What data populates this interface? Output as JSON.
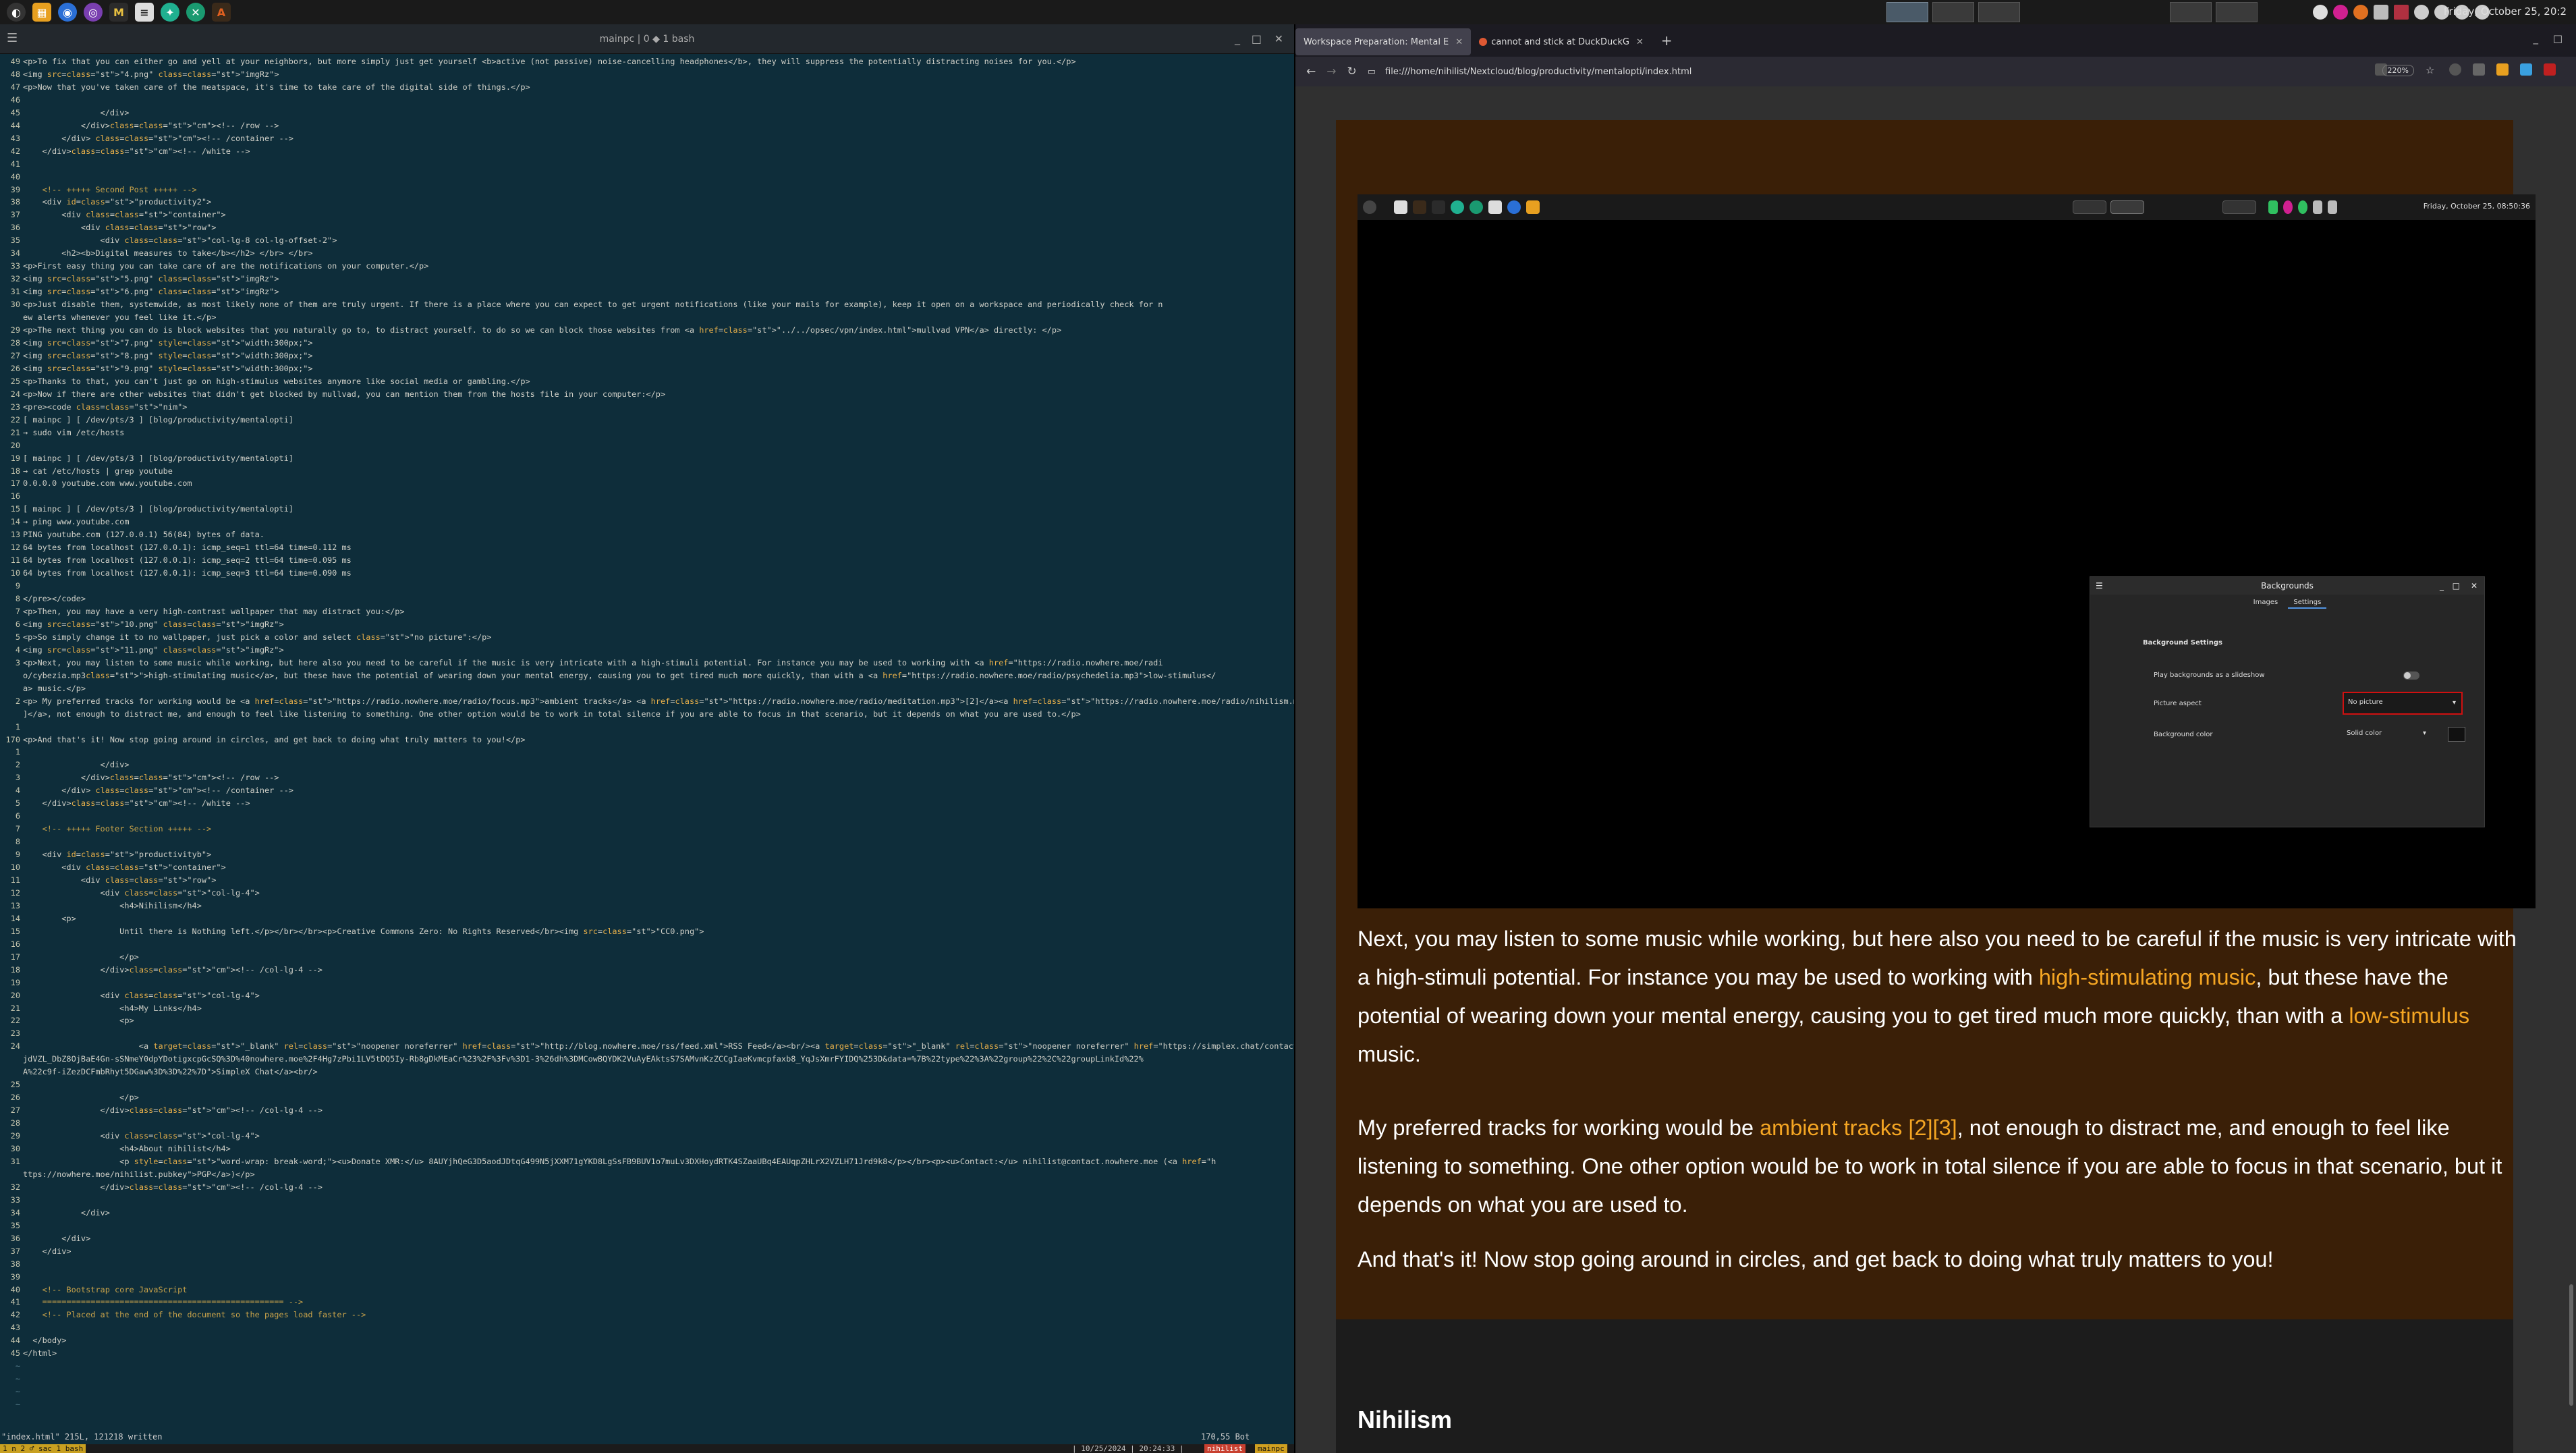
{
  "panel": {
    "launcher_icons": [
      "app-menu-icon",
      "files-icon",
      "firefox-icon",
      "tor-icon",
      "thunderbird-icon",
      "editor-icon",
      "app-icon",
      "app-icon",
      "app-icon"
    ],
    "clock": "Friday, October 25, 20:2"
  },
  "terminal": {
    "title": "mainpc | 0 ◆ 1 bash",
    "status_left": "\"index.html\" 215L, 121218 written",
    "status_right": "170,55        Bot",
    "tmux_left": "1 n    2 ♂ sac    1 bash",
    "tmux_date": "| 10/25/2024 | 20:24:33 |",
    "tmux_user": "nihilist",
    "tmux_host": "mainpc"
  },
  "code_lines": [
    {
      "n": "49",
      "t": "<p>To fix that you can either go and yell at your neighbors, but more simply just get yourself <b>active (not passive) noise-cancelling headphones</b>, they will suppress the potentially distracting noises for you.</p>"
    },
    {
      "n": "48",
      "t": "<img src=\"4.png\" class=\"imgRz\">"
    },
    {
      "n": "47",
      "t": "<p>Now that you've taken care of the meatspace, it's time to take care of the digital side of things.</p>"
    },
    {
      "n": "46",
      "t": ""
    },
    {
      "n": "45",
      "t": "                </div>"
    },
    {
      "n": "44",
      "t": "            </div><!-- /row -->"
    },
    {
      "n": "43",
      "t": "        </div> <!-- /container -->"
    },
    {
      "n": "42",
      "t": "    </div><!-- /white -->"
    },
    {
      "n": "41",
      "t": ""
    },
    {
      "n": "40",
      "t": ""
    },
    {
      "n": "39",
      "t": "    <!-- +++++ Second Post +++++ -->"
    },
    {
      "n": "38",
      "t": "    <div id=\"productivity2\">"
    },
    {
      "n": "37",
      "t": "        <div class=\"container\">"
    },
    {
      "n": "36",
      "t": "            <div class=\"row\">"
    },
    {
      "n": "35",
      "t": "                <div class=\"col-lg-8 col-lg-offset-2\">"
    },
    {
      "n": "34",
      "t": "        <h2><b>Digital measures to take</b></h2> </br> </br>"
    },
    {
      "n": "33",
      "t": "<p>First easy thing you can take care of are the notifications on your computer.</p>"
    },
    {
      "n": "32",
      "t": "<img src=\"5.png\" class=\"imgRz\">"
    },
    {
      "n": "31",
      "t": "<img src=\"6.png\" class=\"imgRz\">"
    },
    {
      "n": "30",
      "t": "<p>Just disable them, systemwide, as most likely none of them are truly urgent. If there is a place where you can expect to get urgent notifications (like your mails for example), keep it open on a workspace and periodically check for n"
    },
    {
      "n": "",
      "t": "ew alerts whenever you feel like it.</p>"
    },
    {
      "n": "29",
      "t": "<p>The next thing you can do is block websites that you naturally go to, to distract yourself. to do so we can block those websites from <a href=\"../../opsec/vpn/index.html\">mullvad VPN</a> directly: </p>"
    },
    {
      "n": "28",
      "t": "<img src=\"7.png\" style=\"width:300px;\">"
    },
    {
      "n": "27",
      "t": "<img src=\"8.png\" style=\"width:300px;\">"
    },
    {
      "n": "26",
      "t": "<img src=\"9.png\" style=\"width:300px;\">"
    },
    {
      "n": "25",
      "t": "<p>Thanks to that, you can't just go on high-stimulus websites anymore like social media or gambling.</p>"
    },
    {
      "n": "24",
      "t": "<p>Now if there are other websites that didn't get blocked by mullvad, you can mention them from the hosts file in your computer:</p>"
    },
    {
      "n": "23",
      "t": "<pre><code class=\"nim\">"
    },
    {
      "n": "22",
      "t": "[ mainpc ] [ /dev/pts/3 ] [blog/productivity/mentalopti]"
    },
    {
      "n": "21",
      "t": "→ sudo vim /etc/hosts"
    },
    {
      "n": "20",
      "t": ""
    },
    {
      "n": "19",
      "t": "[ mainpc ] [ /dev/pts/3 ] [blog/productivity/mentalopti]"
    },
    {
      "n": "18",
      "t": "→ cat /etc/hosts | grep youtube"
    },
    {
      "n": "17",
      "t": "0.0.0.0 youtube.com www.youtube.com"
    },
    {
      "n": "16",
      "t": ""
    },
    {
      "n": "15",
      "t": "[ mainpc ] [ /dev/pts/3 ] [blog/productivity/mentalopti]"
    },
    {
      "n": "14",
      "t": "→ ping www.youtube.com"
    },
    {
      "n": "13",
      "t": "PING youtube.com (127.0.0.1) 56(84) bytes of data."
    },
    {
      "n": "12",
      "t": "64 bytes from localhost (127.0.0.1): icmp_seq=1 ttl=64 time=0.112 ms"
    },
    {
      "n": "11",
      "t": "64 bytes from localhost (127.0.0.1): icmp_seq=2 ttl=64 time=0.095 ms"
    },
    {
      "n": "10",
      "t": "64 bytes from localhost (127.0.0.1): icmp_seq=3 ttl=64 time=0.090 ms"
    },
    {
      "n": "9",
      "t": ""
    },
    {
      "n": "8",
      "t": "</pre></code>"
    },
    {
      "n": "7",
      "t": "<p>Then, you may have a very high-contrast wallpaper that may distract you:</p>"
    },
    {
      "n": "6",
      "t": "<img src=\"10.png\" class=\"imgRz\">"
    },
    {
      "n": "5",
      "t": "<p>So simply change it to no wallpaper, just pick a color and select \"no picture\":</p>"
    },
    {
      "n": "4",
      "t": "<img src=\"11.png\" class=\"imgRz\">"
    },
    {
      "n": "3",
      "t": "<p>Next, you may listen to some music while working, but here also you need to be careful if the music is very intricate with a high-stimuli potential. For instance you may be used to working with <a href=\"https://radio.nowhere.moe/radi"
    },
    {
      "n": "",
      "t": "o/cybezia.mp3\">high-stimulating music</a>, but these have the potential of wearing down your mental energy, causing you to get tired much more quickly, than with a <a href=\"https://radio.nowhere.moe/radio/psychedelia.mp3\">low-stimulus</"
    },
    {
      "n": "",
      "t": "a> music.</p>"
    },
    {
      "n": "2",
      "t": "<p> My preferred tracks for working would be <a href=\"https://radio.nowhere.moe/radio/focus.mp3\">ambient tracks</a> <a href=\"https://radio.nowhere.moe/radio/meditation.mp3\">[2]</a><a href=\"https://radio.nowhere.moe/radio/nihilism.mp3\">[3"
    },
    {
      "n": "",
      "t": "]</a>, not enough to distract me, and enough to feel like listening to something. One other option would be to work in total silence if you are able to focus in that scenario, but it depends on what you are used to.</p>"
    },
    {
      "n": "1",
      "t": ""
    },
    {
      "n": "170",
      "t": "<p>And that's it! Now stop going around in circles, and get back to doing what truly matters to you!</p>"
    },
    {
      "n": "1",
      "t": ""
    },
    {
      "n": "2",
      "t": "                </div>"
    },
    {
      "n": "3",
      "t": "            </div><!-- /row -->"
    },
    {
      "n": "4",
      "t": "        </div> <!-- /container -->"
    },
    {
      "n": "5",
      "t": "    </div><!-- /white -->"
    },
    {
      "n": "6",
      "t": ""
    },
    {
      "n": "7",
      "t": "    <!-- +++++ Footer Section +++++ -->"
    },
    {
      "n": "8",
      "t": ""
    },
    {
      "n": "9",
      "t": "    <div id=\"productivityb\">"
    },
    {
      "n": "10",
      "t": "        <div class=\"container\">"
    },
    {
      "n": "11",
      "t": "            <div class=\"row\">"
    },
    {
      "n": "12",
      "t": "                <div class=\"col-lg-4\">"
    },
    {
      "n": "13",
      "t": "                    <h4>Nihilism</h4>"
    },
    {
      "n": "14",
      "t": "        <p>"
    },
    {
      "n": "15",
      "t": "                    Until there is Nothing left.</p></br></br><p>Creative Commons Zero: No Rights Reserved</br><img src=\"CC0.png\">"
    },
    {
      "n": "16",
      "t": ""
    },
    {
      "n": "17",
      "t": "                    </p>"
    },
    {
      "n": "18",
      "t": "                </div><!-- /col-lg-4 -->"
    },
    {
      "n": "19",
      "t": ""
    },
    {
      "n": "20",
      "t": "                <div class=\"col-lg-4\">"
    },
    {
      "n": "21",
      "t": "                    <h4>My Links</h4>"
    },
    {
      "n": "22",
      "t": "                    <p>"
    },
    {
      "n": "23",
      "t": ""
    },
    {
      "n": "24",
      "t": "                        <a target=\"_blank\" rel=\"noopener noreferrer\" href=\"http://blog.nowhere.moe/rss/feed.xml\">RSS Feed</a><br/><a target=\"_blank\" rel=\"noopener noreferrer\" href=\"https://simplex.chat/contact#/?v=2-7&smp=smp%3A%2F%2FL5"
    },
    {
      "n": "",
      "t": "jdVZL_DbZ8OjBaE4Gn-sSNmeY0dpYDotigxcpGcSQ%3D%40nowhere.moe%2F4Hg7zPbi1LV5tDQ5Iy-Rb8gDkMEaCr%23%2F%3Fv%3D1-3%26dh%3DMCowBQYDK2VuAyEAktsS7SAMvnKzZCCgIaeKvmcpfaxb8_YqJsXmrFYIDQ%253D&data=%7B%22type%22%3A%22group%22%2C%22groupLinkId%22%"
    },
    {
      "n": "",
      "t": "A%22c9f-iZezDCFmbRhyt5DGaw%3D%3D%22%7D\">SimpleX Chat</a><br/>"
    },
    {
      "n": "25",
      "t": ""
    },
    {
      "n": "26",
      "t": "                    </p>"
    },
    {
      "n": "27",
      "t": "                </div><!-- /col-lg-4 -->"
    },
    {
      "n": "28",
      "t": ""
    },
    {
      "n": "29",
      "t": "                <div class=\"col-lg-4\">"
    },
    {
      "n": "30",
      "t": "                    <h4>About nihilist</h4>"
    },
    {
      "n": "31",
      "t": "                    <p style=\"word-wrap: break-word;\"><u>Donate XMR:</u> 8AUYjhQeG3D5aodJDtqG499N5jXXM71gYKD8LgSsFB9BUV1o7muLv3DXHoydRTK4SZaaUBq4EAUqpZHLrX2VZLH71Jrd9k8</p></br><p><u>Contact:</u> nihilist@contact.nowhere.moe (<a href=\"h"
    },
    {
      "n": "",
      "t": "ttps://nowhere.moe/nihilist.pubkey\">PGP</a>)</p>"
    },
    {
      "n": "32",
      "t": "                </div><!-- /col-lg-4 -->"
    },
    {
      "n": "33",
      "t": ""
    },
    {
      "n": "34",
      "t": "            </div>"
    },
    {
      "n": "35",
      "t": ""
    },
    {
      "n": "36",
      "t": "        </div>"
    },
    {
      "n": "37",
      "t": "    </div>"
    },
    {
      "n": "38",
      "t": ""
    },
    {
      "n": "39",
      "t": ""
    },
    {
      "n": "40",
      "t": "    <!-- Bootstrap core JavaScript"
    },
    {
      "n": "41",
      "t": "    ================================================== -->"
    },
    {
      "n": "42",
      "t": "    <!-- Placed at the end of the document so the pages load faster -->"
    },
    {
      "n": "43",
      "t": ""
    },
    {
      "n": "44",
      "t": "  </body>"
    },
    {
      "n": "45",
      "t": "</html>"
    },
    {
      "n": "~",
      "t": ""
    },
    {
      "n": "~",
      "t": ""
    },
    {
      "n": "~",
      "t": ""
    },
    {
      "n": "~",
      "t": ""
    }
  ],
  "browser": {
    "tabs": [
      {
        "label": "Workspace Preparation: Mental E",
        "active": true
      },
      {
        "label": "cannot and stick at DuckDuckG",
        "active": false
      }
    ],
    "url": "file:///home/nihilist/Nextcloud/blog/productivity/mentalopti/index.html",
    "zoom": "220%"
  },
  "embedded": {
    "clock": "Friday, October 25, 08:50:36",
    "dialog": {
      "title": "Backgrounds",
      "tabs": [
        "Images",
        "Settings"
      ],
      "section": "Background Settings",
      "row_slideshow": "Play backgrounds as a slideshow",
      "row_aspect": "Picture aspect",
      "aspect_value": "No picture",
      "row_color": "Background color",
      "color_value": "Solid color"
    }
  },
  "article": {
    "p1_a": "Next, you may listen to some music while working, but here also you need to be careful if the music is very intricate with a high-stimuli potential. For instance you may be used to working with ",
    "p1_link1": "high-stimulating music",
    "p1_b": ", but these have the potential of wearing down your mental energy, causing you to get tired much more quickly, than with a ",
    "p1_link2": "low-stimulus",
    "p1_c": " music.",
    "p2_a": "My preferred tracks for working would be ",
    "p2_link1": "ambient tracks",
    "p2_link2": "[2]",
    "p2_link3": "[3]",
    "p2_b": ", not enough to distract me, and enough to feel like listening to something. One other option would be to work in total silence if you are able to focus in that scenario, but it depends on what you are used to.",
    "p3": "And that's it! Now stop going around in circles, and get back to doing what truly matters to you!",
    "footer_heading": "Nihilism"
  }
}
